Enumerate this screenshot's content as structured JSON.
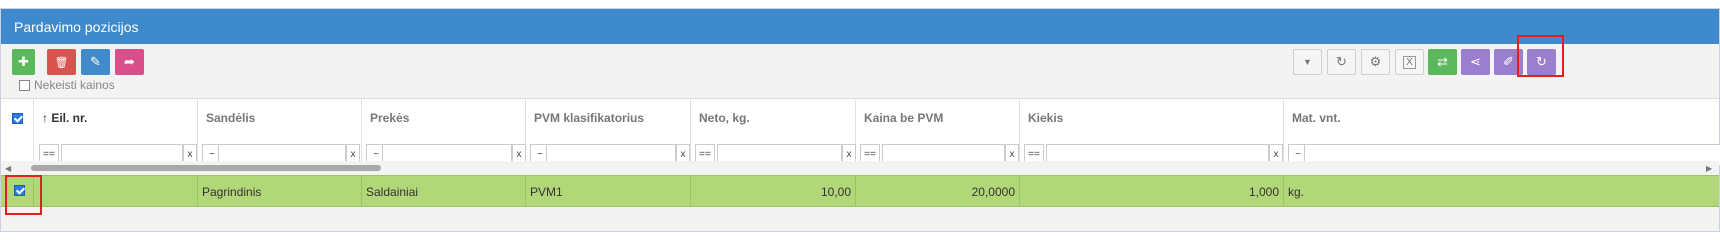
{
  "panel_title": "Pardavimo pozicijos",
  "toolbar": {
    "left_buttons": [
      {
        "icon": "plus-icon",
        "glyph": "✚",
        "color": "#5cb85c"
      },
      {
        "icon": "trash-icon",
        "glyph": "🗑",
        "color": "#d9534f"
      },
      {
        "icon": "pencil-icon",
        "glyph": "✎",
        "color": "#428bca"
      },
      {
        "icon": "share-arrow-icon",
        "glyph": "➦",
        "color": "#d94f8a"
      }
    ],
    "right_buttons": [
      {
        "icon": "filter-icon",
        "glyph": "▼"
      },
      {
        "icon": "refresh-icon",
        "glyph": "↻"
      },
      {
        "icon": "gear-icon",
        "glyph": "⚙"
      },
      {
        "icon": "excel-icon",
        "glyph": "X"
      },
      {
        "icon": "exchange-icon",
        "glyph": "⇄"
      },
      {
        "icon": "share-icon",
        "glyph": "⋖"
      },
      {
        "icon": "eraser-icon",
        "glyph": "✐"
      },
      {
        "icon": "refresh-icon",
        "glyph": "↻"
      }
    ]
  },
  "nekeisti_kainos_label": "Nekeisti kainos",
  "columns": [
    "Eil. nr.",
    "Sandėlis",
    "Prekės",
    "PVM klasifikatorius",
    "Neto, kg.",
    "Kaina be PVM",
    "Kiekis",
    "Mat. vnt."
  ],
  "sort_indicator": "↑",
  "filters": [
    "==",
    "~",
    "~",
    "~",
    "==",
    "==",
    "==",
    "~"
  ],
  "filter_clear": "x",
  "rows": [
    {
      "eil_nr": "",
      "sandelis": "Pagrindinis",
      "preke": "Saldainiai",
      "pvm": "PVM1",
      "neto": "10,00",
      "kaina": "20,0000",
      "kiekis": "1,000",
      "mat": "kg."
    }
  ]
}
